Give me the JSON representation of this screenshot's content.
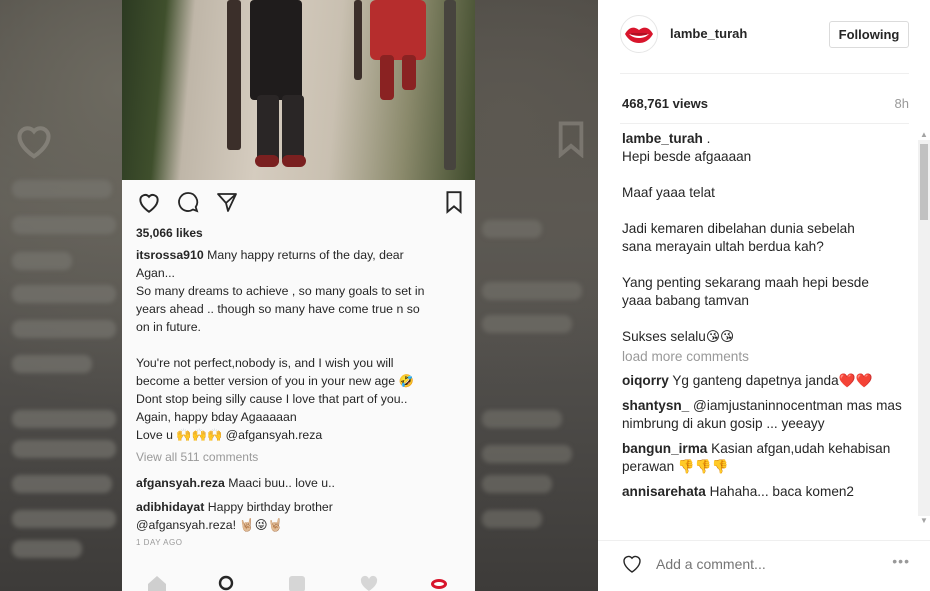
{
  "post_image": {
    "phone_screen": {
      "likes": "35,066 likes",
      "caption_user": "itsrossa910",
      "caption_lines": [
        "Many happy returns of the day, dear",
        "Agan...",
        "So many dreams to achieve , so many goals to set in",
        "years ahead .. though  so many have come true n so",
        "on in future.",
        "",
        "You're not perfect,nobody is, and I wish you will",
        "become a better version of you in your new age 🤣",
        "Dont stop being silly cause I love that part of you..",
        "Again, happy bday Agaaaaan",
        "Love u 🙌🙌🙌 @afgansyah.reza"
      ],
      "view_all": "View all 511 comments",
      "comments": [
        {
          "user": "afgansyah.reza",
          "text": "Maaci buu.. love u.."
        },
        {
          "user": "adibhidayat",
          "text": "Happy birthday brother"
        },
        {
          "user": "",
          "text": "@afgansyah.reza! 🤘🏼😜🤘🏼"
        }
      ],
      "time": "1 DAY AGO"
    }
  },
  "header": {
    "username": "lambe_turah",
    "follow_label": "Following"
  },
  "stats": {
    "views": "468,761 views",
    "time_ago": "8h"
  },
  "caption": {
    "user": "lambe_turah",
    "lines": [
      ".",
      "Hepi besde afgaaaan",
      "",
      "Maaf yaaa telat",
      "",
      "Jadi kemaren dibelahan dunia sebelah",
      "sana merayain ultah berdua kah?",
      "",
      "Yang penting sekarang maah hepi besde",
      "yaaa babang tamvan",
      "",
      "Sukses selalu😘😘"
    ]
  },
  "load_more": "load more comments",
  "comments": [
    {
      "user": "oiqorry",
      "text": "Yg ganteng dapetnya janda❤️❤️"
    },
    {
      "user": "shantysn_",
      "text": "@iamjustaninnocentman mas mas nimbrung di akun gosip ... yeeayy"
    },
    {
      "user": "bangun_irma",
      "text": "Kasian afgan,udah kehabisan perawan 👎👎👎"
    },
    {
      "user": "annisarehata",
      "text": "Hahaha... baca komen2"
    }
  ],
  "footer": {
    "add_comment_placeholder": "Add a comment...",
    "more_label": "•••"
  },
  "colors": {
    "accent_red": "#d8152c",
    "text": "#262626",
    "muted": "#999999",
    "border": "#dbdbdb"
  },
  "icons": {
    "like": "heart-icon",
    "comment": "comment-icon",
    "share": "share-icon",
    "save": "bookmark-icon",
    "options": "more-options-icon"
  }
}
